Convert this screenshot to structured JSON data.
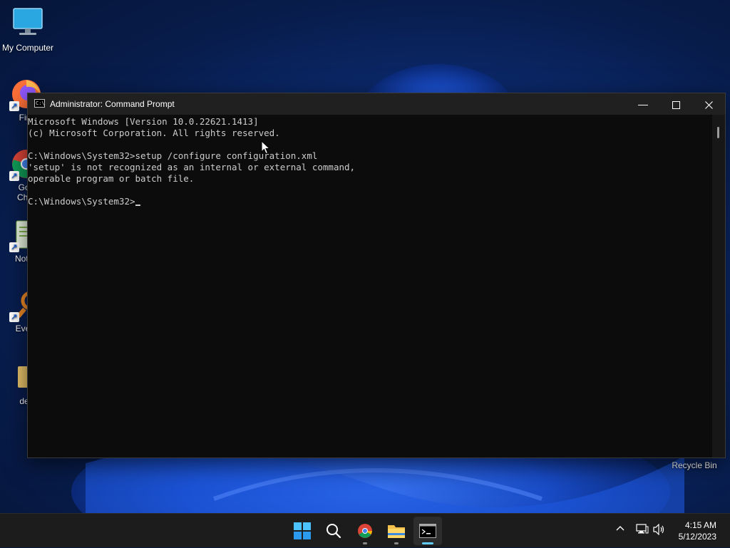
{
  "desktop": {
    "icons": [
      {
        "label": "My Computer"
      },
      {
        "label": "Fire"
      },
      {
        "label": "Goo\nChro"
      },
      {
        "label": "Notep"
      },
      {
        "label": "Every"
      },
      {
        "label": "des"
      },
      {
        "label": "Recycle Bin"
      }
    ]
  },
  "window": {
    "title": "Administrator: Command Prompt",
    "icon_text": "C:\\",
    "console_lines": [
      "Microsoft Windows [Version 10.0.22621.1413]",
      "(c) Microsoft Corporation. All rights reserved.",
      "",
      "C:\\Windows\\System32>setup /configure configuration.xml",
      "'setup' is not recognized as an internal or external command,",
      "operable program or batch file.",
      ""
    ],
    "prompt": "C:\\Windows\\System32>"
  },
  "taskbar": {
    "apps": [
      {
        "name": "start",
        "icon": "windows-logo-icon"
      },
      {
        "name": "search",
        "icon": "search-icon"
      },
      {
        "name": "chrome",
        "icon": "chrome-icon"
      },
      {
        "name": "file-explorer",
        "icon": "folder-icon"
      },
      {
        "name": "command-prompt",
        "icon": "terminal-icon"
      }
    ],
    "time": "4:15 AM",
    "date": "5/12/2023"
  },
  "colors": {
    "accent": "#60cdff",
    "console_bg": "#0c0c0c",
    "console_fg": "#cccccc",
    "taskbar_bg": "#1c1c1c"
  }
}
